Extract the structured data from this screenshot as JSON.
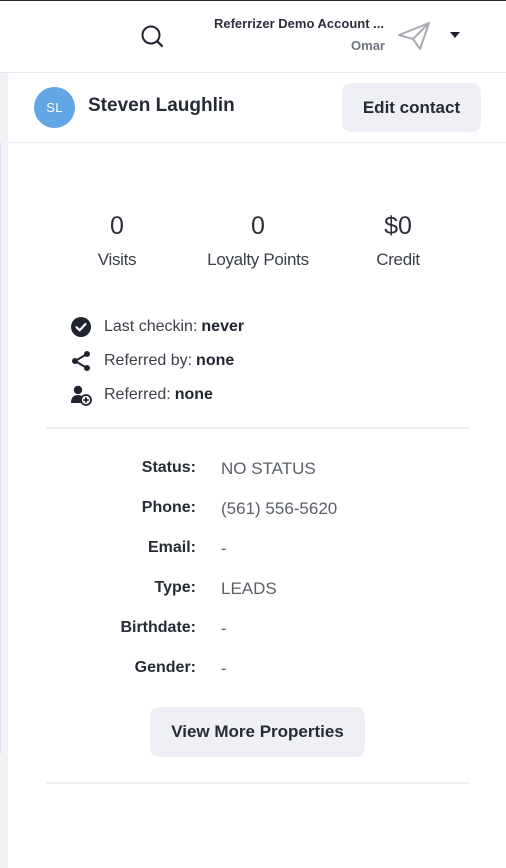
{
  "header": {
    "account_name": "Referrizer Demo Account ...",
    "account_user": "Omar",
    "search_icon": "search-icon",
    "send_icon": "paper-plane-icon",
    "caret_icon": "caret-down-icon"
  },
  "contact": {
    "initials": "SL",
    "name": "Steven Laughlin",
    "edit_label": "Edit contact",
    "avatar_color": "#62a6e6"
  },
  "stats": [
    {
      "value": "0",
      "label": "Visits"
    },
    {
      "value": "0",
      "label": "Loyalty Points"
    },
    {
      "value": "$0",
      "label": "Credit"
    }
  ],
  "info": {
    "checkin_label": "Last checkin:",
    "checkin_value": "never",
    "referred_by_label": "Referred by:",
    "referred_by_value": "none",
    "referred_label": "Referred:",
    "referred_value": "none"
  },
  "properties": [
    {
      "label": "Status:",
      "value": "NO STATUS"
    },
    {
      "label": "Phone:",
      "value": "(561) 556-5620"
    },
    {
      "label": "Email:",
      "value": "-"
    },
    {
      "label": "Type:",
      "value": "LEADS"
    },
    {
      "label": "Birthdate:",
      "value": "-"
    },
    {
      "label": "Gender:",
      "value": "-"
    }
  ],
  "view_more_label": "View More Properties"
}
